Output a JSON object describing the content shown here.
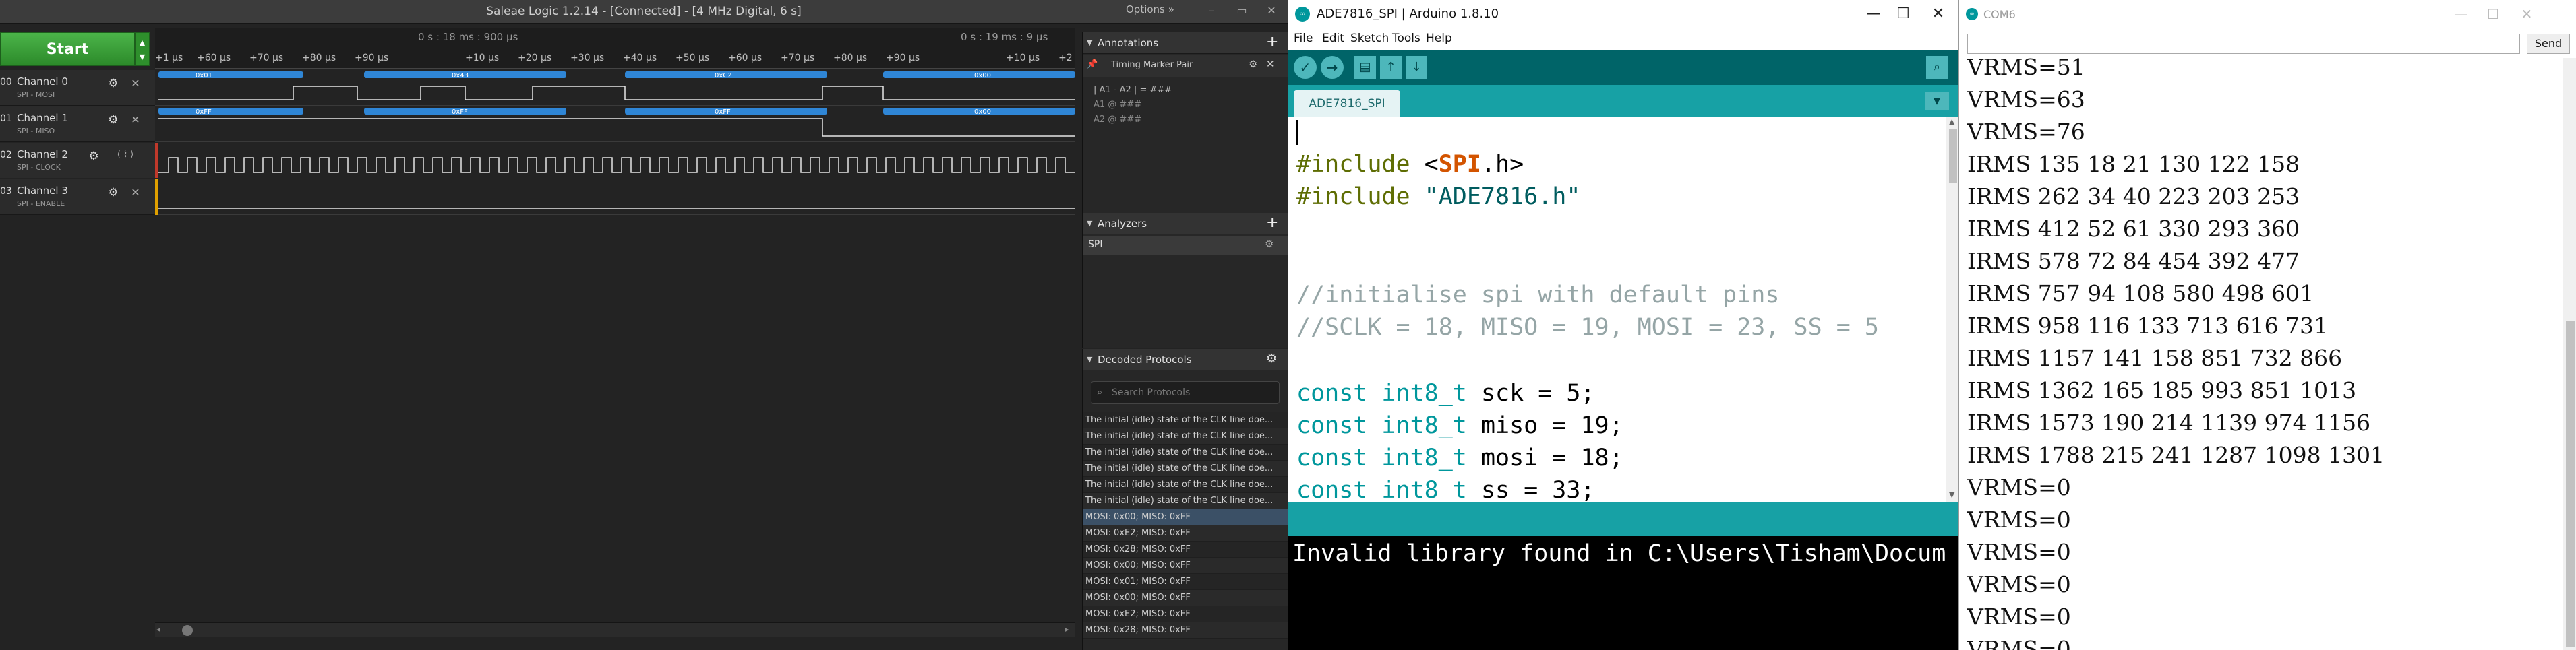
{
  "saleae": {
    "title": "Saleae Logic 1.2.14 - [Connected] - [4 MHz Digital, 6 s]",
    "options_label": "Options »",
    "window_buttons": [
      "–",
      "▭",
      "✕"
    ],
    "start_label": "Start",
    "ruler": {
      "time_left": "0 s : 18 ms : 900 µs",
      "time_right": "0 s : 19 ms : 9 µs",
      "ticks_a": [
        "+1 µs",
        "+60 µs",
        "+70 µs",
        "+80 µs",
        "+90 µs"
      ],
      "ticks_b": [
        "+10 µs",
        "+20 µs",
        "+30 µs",
        "+40 µs",
        "+50 µs",
        "+60 µs",
        "+70 µs",
        "+80 µs",
        "+90 µs"
      ],
      "ticks_c": [
        "+10 µs",
        "+2"
      ]
    },
    "channels": [
      {
        "num": "00",
        "name": "Channel 0",
        "sub": "SPI - MOSI"
      },
      {
        "num": "01",
        "name": "Channel 1",
        "sub": "SPI - MISO"
      },
      {
        "num": "02",
        "name": "Channel 2",
        "sub": "SPI - CLOCK"
      },
      {
        "num": "03",
        "name": "Channel 3",
        "sub": "SPI - ENABLE"
      }
    ],
    "mosi_bytes": [
      "0x01",
      "0x43",
      "0xC2",
      "0x00"
    ],
    "miso_bytes": [
      "0xFF",
      "0xFF",
      "0xFF",
      "0x00"
    ],
    "annotations": {
      "header": "Annotations",
      "marker_pair": "Timing Marker Pair",
      "a1_a2": "| A1 - A2 | = ###",
      "a1": "A1 @ ###",
      "a2": "A2 @ ###"
    },
    "analyzers": {
      "header": "Analyzers",
      "items": [
        "SPI"
      ]
    },
    "decoded": {
      "header": "Decoded Protocols",
      "search_placeholder": "Search Protocols",
      "rows": [
        "The initial (idle) state of the CLK line doe...",
        "The initial (idle) state of the CLK line doe...",
        "The initial (idle) state of the CLK line doe...",
        "The initial (idle) state of the CLK line doe...",
        "The initial (idle) state of the CLK line doe...",
        "The initial (idle) state of the CLK line doe...",
        "MOSI: 0x00;  MISO: 0xFF",
        "MOSI: 0xE2;  MISO: 0xFF",
        "MOSI: 0x28;  MISO: 0xFF",
        "MOSI: 0x00;  MISO: 0xFF",
        "MOSI: 0x01;  MISO: 0xFF",
        "MOSI: 0x00;  MISO: 0xFF",
        "MOSI: 0xE2;  MISO: 0xFF",
        "MOSI: 0x28;  MISO: 0xFF"
      ]
    }
  },
  "arduino": {
    "title": "ADE7816_SPI | Arduino 1.8.10",
    "menu": [
      "File",
      "Edit",
      "Sketch",
      "Tools",
      "Help"
    ],
    "tab_label": "ADE7816_SPI",
    "code": {
      "l1_a": "#include",
      "l1_b": " <",
      "l1_c": "SPI",
      "l1_d": ".h>",
      "l2_a": "#include",
      "l2_b": " \"ADE7816.h\"",
      "l3": "//initialise spi with default pins",
      "l4": "//SCLK = 18, MISO = 19, MOSI = 23, SS = 5",
      "l5_a": "const int8_t",
      "l5_b": " sck = 5;",
      "l6_a": "const int8_t",
      "l6_b": " miso = 19;",
      "l7_a": "const int8_t",
      "l7_b": " mosi = 18;",
      "l8_a": "const int8_t",
      "l8_b": " ss = 33;"
    },
    "console_text": "Invalid library found in C:\\Users\\Tisham\\Docum"
  },
  "serial": {
    "title": "COM6",
    "send_label": "Send",
    "lines": [
      "VRMS=51",
      "VRMS=63",
      "VRMS=76",
      "IRMS 135 18 21 130 122 158",
      "IRMS 262 34 40 223 203 253",
      "IRMS 412 52 61 330 293 360",
      "IRMS 578 72 84 454 392 477",
      "IRMS 757 94 108 580 498 601",
      "IRMS 958 116 133 713 616 731",
      "IRMS 1157 141 158 851 732 866",
      "IRMS 1362 165 185 993 851 1013",
      "IRMS 1573 190 214 1139 974 1156",
      "IRMS 1788 215 241 1287 1098 1301",
      "VRMS=0",
      "VRMS=0",
      "VRMS=0",
      "VRMS=0",
      "VRMS=0",
      "VRMS=0"
    ]
  },
  "colors": {
    "arduino_teal": "#00979c",
    "saleae_green": "#3aa138",
    "protocol_bubble": "#2f86d6"
  }
}
